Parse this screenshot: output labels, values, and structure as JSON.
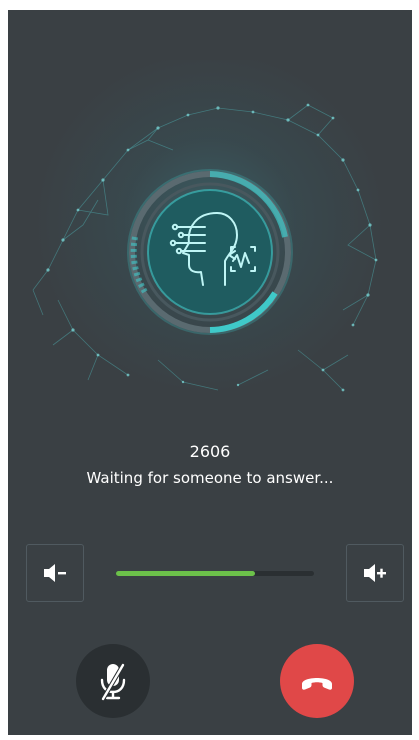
{
  "call": {
    "number": "2606",
    "status": "Waiting for someone to answer..."
  },
  "volume": {
    "level": 0.7,
    "fill_color": "#6cc14a"
  },
  "controls": {
    "volume_down_icon": "speaker-minus-icon",
    "volume_up_icon": "speaker-plus-icon",
    "mute_icon": "microphone-off-icon",
    "hangup_icon": "phone-hangup-icon",
    "hangup_color": "#e04848"
  },
  "theme": {
    "background": "#3a4044",
    "accent": "#3fc9c9"
  }
}
